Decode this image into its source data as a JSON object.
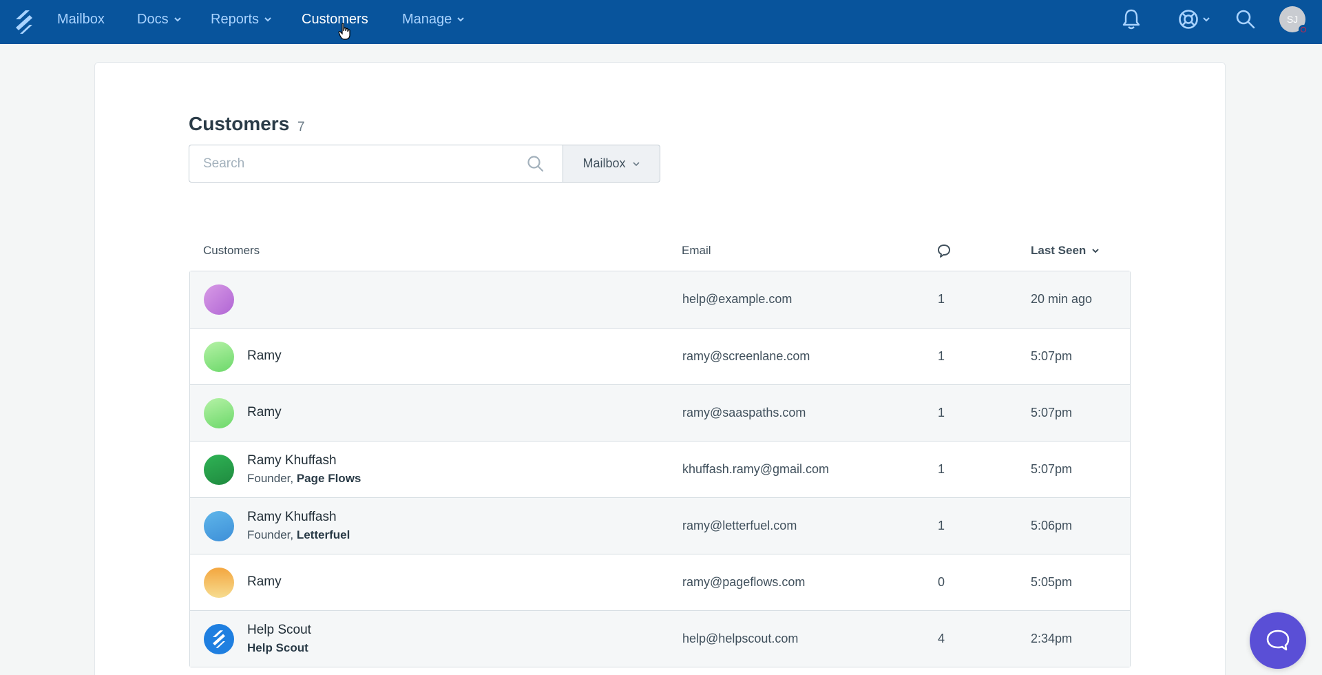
{
  "nav": {
    "items": [
      {
        "label": "Mailbox",
        "dropdown": false,
        "active": false
      },
      {
        "label": "Docs",
        "dropdown": true,
        "active": false
      },
      {
        "label": "Reports",
        "dropdown": true,
        "active": false
      },
      {
        "label": "Customers",
        "dropdown": false,
        "active": true
      },
      {
        "label": "Manage",
        "dropdown": true,
        "active": false
      }
    ],
    "user_initials": "SJ",
    "icons": [
      "bell-icon",
      "lifebuoy-icon",
      "search-icon"
    ]
  },
  "page": {
    "title": "Customers",
    "count": "7"
  },
  "search": {
    "placeholder": "Search",
    "value": "",
    "mailbox_filter_label": "Mailbox"
  },
  "table": {
    "headers": {
      "customers": "Customers",
      "email": "Email",
      "conversations_icon": "chat-bubble-icon",
      "last_seen": "Last Seen"
    },
    "rows": [
      {
        "name": "",
        "title": "",
        "company": "",
        "email": "help@example.com",
        "conversations": "1",
        "last_seen": "20 min ago",
        "avatar_colors": [
          "#c98ddf",
          "#b065d4"
        ]
      },
      {
        "name": "Ramy",
        "title": "",
        "company": "",
        "email": "ramy@screenlane.com",
        "conversations": "1",
        "last_seen": "5:07pm",
        "avatar_colors": [
          "#a9ee9a",
          "#6cd86a"
        ]
      },
      {
        "name": "Ramy",
        "title": "",
        "company": "",
        "email": "ramy@saaspaths.com",
        "conversations": "1",
        "last_seen": "5:07pm",
        "avatar_colors": [
          "#a9ee9a",
          "#6cd86a"
        ]
      },
      {
        "name": "Ramy Khuffash",
        "title": "Founder,",
        "company": "Page Flows",
        "email": "khuffash.ramy@gmail.com",
        "conversations": "1",
        "last_seen": "5:07pm",
        "avatar_colors": [
          "#2fa84f",
          "#1f8a3f"
        ]
      },
      {
        "name": "Ramy Khuffash",
        "title": "Founder,",
        "company": "Letterfuel",
        "email": "ramy@letterfuel.com",
        "conversations": "1",
        "last_seen": "5:06pm",
        "avatar_colors": [
          "#5fb0e8",
          "#3d8fd8"
        ]
      },
      {
        "name": "Ramy",
        "title": "",
        "company": "",
        "email": "ramy@pageflows.com",
        "conversations": "0",
        "last_seen": "5:05pm",
        "avatar_colors": [
          "#f4a63f",
          "#f6dc90"
        ]
      },
      {
        "name": "Help Scout",
        "title": "",
        "company": "Help Scout",
        "email": "help@helpscout.com",
        "conversations": "4",
        "last_seen": "2:34pm",
        "avatar_colors": [
          "#1f7fe0",
          "#1f7fe0"
        ]
      }
    ]
  },
  "colors": {
    "nav_bg": "#08549c",
    "nav_text": "#a9d3ff",
    "beacon": "#5a4fd6"
  }
}
